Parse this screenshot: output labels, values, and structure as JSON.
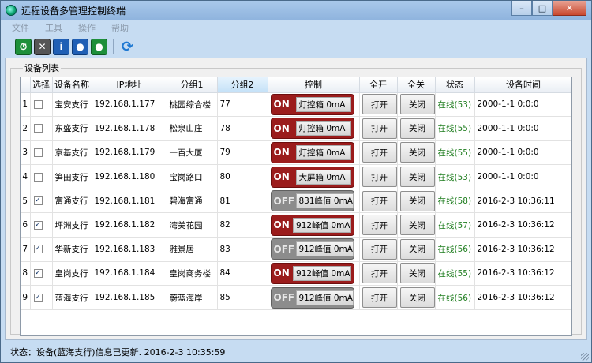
{
  "window": {
    "title": "远程设备多管理控制终端"
  },
  "window_controls": {
    "minimize": "–",
    "maximize": "□",
    "close": "✕"
  },
  "menu": [
    "文件",
    "工具",
    "操作",
    "帮助"
  ],
  "toolbar": {
    "icons": [
      "clock-icon",
      "tools-icon",
      "info-icon",
      "group-icon",
      "group-add-icon",
      "refresh-icon"
    ],
    "glyphs": [
      "⏱",
      "✕",
      "i",
      "●",
      "●",
      "⟳"
    ]
  },
  "group": {
    "legend": "设备列表"
  },
  "columns": [
    "",
    "选择",
    "设备名称",
    "IP地址",
    "分组1",
    "分组2",
    "控制",
    "全开",
    "全关",
    "状态",
    "设备时间"
  ],
  "rows": [
    {
      "idx": "1",
      "checked": false,
      "name": "宝安支行",
      "ip": "192.168.1.177",
      "group1": "桃园综合楼",
      "group2": "77",
      "ctrl_state": "ON",
      "ctrl_label": "灯控箱 0mA",
      "open": "打开",
      "close": "关闭",
      "status": "在线(53)",
      "time": "2000-1-1 0:0:0"
    },
    {
      "idx": "2",
      "checked": false,
      "name": "东盛支行",
      "ip": "192.168.1.178",
      "group1": "松泉山庄",
      "group2": "78",
      "ctrl_state": "ON",
      "ctrl_label": "灯控箱 0mA",
      "open": "打开",
      "close": "关闭",
      "status": "在线(55)",
      "time": "2000-1-1 0:0:0"
    },
    {
      "idx": "3",
      "checked": false,
      "name": "京基支行",
      "ip": "192.168.1.179",
      "group1": "一百大厦",
      "group2": "79",
      "ctrl_state": "ON",
      "ctrl_label": "灯控箱 0mA",
      "open": "打开",
      "close": "关闭",
      "status": "在线(55)",
      "time": "2000-1-1 0:0:0"
    },
    {
      "idx": "4",
      "checked": false,
      "name": "笋田支行",
      "ip": "192.168.1.180",
      "group1": "宝岗路口",
      "group2": "80",
      "ctrl_state": "ON",
      "ctrl_label": "大屏箱 0mA",
      "open": "打开",
      "close": "关闭",
      "status": "在线(53)",
      "time": "2000-1-1 0:0:0"
    },
    {
      "idx": "5",
      "checked": true,
      "name": "富通支行",
      "ip": "192.168.1.181",
      "group1": "碧海富通",
      "group2": "81",
      "ctrl_state": "OFF",
      "ctrl_label": "831峰值 0mA",
      "open": "打开",
      "close": "关闭",
      "status": "在线(58)",
      "time": "2016-2-3 10:36:11"
    },
    {
      "idx": "6",
      "checked": true,
      "name": "坪洲支行",
      "ip": "192.168.1.182",
      "group1": "湾美花园",
      "group2": "82",
      "ctrl_state": "ON",
      "ctrl_label": "912峰值 0mA",
      "open": "打开",
      "close": "关闭",
      "status": "在线(57)",
      "time": "2016-2-3 10:36:12"
    },
    {
      "idx": "7",
      "checked": true,
      "name": "华新支行",
      "ip": "192.168.1.183",
      "group1": "雅景居",
      "group2": "83",
      "ctrl_state": "OFF",
      "ctrl_label": "912峰值 0mA",
      "open": "打开",
      "close": "关闭",
      "status": "在线(56)",
      "time": "2016-2-3 10:36:12"
    },
    {
      "idx": "8",
      "checked": true,
      "name": "皇岗支行",
      "ip": "192.168.1.184",
      "group1": "皇岗商务楼",
      "group2": "84",
      "ctrl_state": "ON",
      "ctrl_label": "912峰值 0mA",
      "open": "打开",
      "close": "关闭",
      "status": "在线(55)",
      "time": "2016-2-3 10:36:12"
    },
    {
      "idx": "9",
      "checked": true,
      "name": "蓝海支行",
      "ip": "192.168.1.185",
      "group1": "蔚蓝海岸",
      "group2": "85",
      "ctrl_state": "OFF",
      "ctrl_label": "912峰值 0mA",
      "open": "打开",
      "close": "关闭",
      "status": "在线(56)",
      "time": "2016-2-3 10:36:12"
    }
  ],
  "status": {
    "text": "状态：设备(蓝海支行)信息已更新. 2016-2-3 10:35:59"
  },
  "colors": {
    "on": "#9b1c1c",
    "off": "#8c8c8c",
    "online": "#1e7d1e"
  }
}
